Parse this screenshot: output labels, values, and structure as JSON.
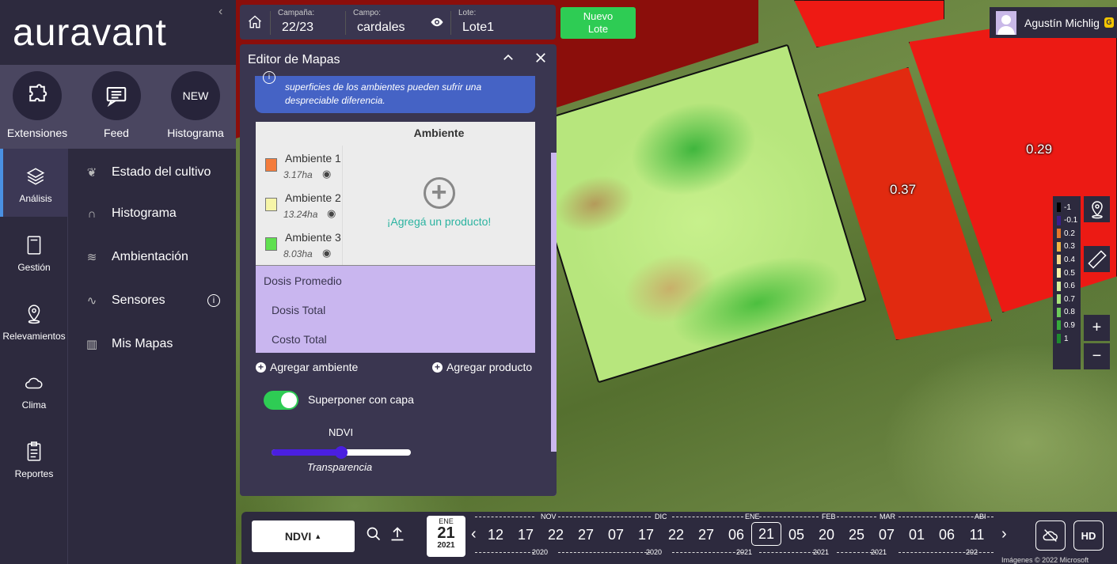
{
  "brand": {
    "logo_text": "auravant",
    "collapse_glyph": "‹"
  },
  "quick_actions": [
    {
      "label": "Extensiones",
      "icon": "puzzle-icon"
    },
    {
      "label": "Feed",
      "icon": "chat-icon"
    },
    {
      "label": "Histograma",
      "icon_text": "NEW"
    }
  ],
  "rail": [
    {
      "label": "Análisis",
      "icon": "layers-icon",
      "active": true
    },
    {
      "label": "Gestión",
      "icon": "notebook-icon"
    },
    {
      "label": "Relevamientos",
      "icon": "map-pin-icon"
    },
    {
      "label": "Clima",
      "icon": "cloud-icon"
    },
    {
      "label": "Reportes",
      "icon": "clipboard-icon"
    }
  ],
  "submenu": [
    {
      "label": "Estado del cultivo",
      "icon": "plant-icon"
    },
    {
      "label": "Histograma",
      "icon": "curve-icon"
    },
    {
      "label": "Ambientación",
      "icon": "layers-icon"
    },
    {
      "label": "Sensores",
      "icon": "wave-icon",
      "has_info": true
    },
    {
      "label": "Mis Mapas",
      "icon": "book-map-icon"
    }
  ],
  "topbar": {
    "campana_label": "Campaña:",
    "campana_value": "22/23",
    "campo_label": "Campo:",
    "campo_value": "cardales",
    "lote_label": "Lote:",
    "lote_value": "Lote1",
    "nuevo_lote": "Nuevo\nLote"
  },
  "user": {
    "name": "Agustín Michlig",
    "badge": "G"
  },
  "editor": {
    "title": "Editor de Mapas",
    "info_text": "superficies de los ambientes pueden sufrir una despreciable diferencia.",
    "column_header": "Ambiente",
    "ambientes": [
      {
        "name": "Ambiente 1",
        "ha": "3.17ha",
        "color": "#f47c3c"
      },
      {
        "name": "Ambiente 2",
        "ha": "13.24ha",
        "color": "#f6f5a8"
      },
      {
        "name": "Ambiente 3",
        "ha": "8.03ha",
        "color": "#5fe04f"
      }
    ],
    "add_product_text": "¡Agregá un producto!",
    "dosis_promedio": "Dosis Promedio",
    "dosis_total": "Dosis Total",
    "costo_total": "Costo Total",
    "agregar_ambiente": "Agregar ambiente",
    "agregar_producto": "Agregar producto",
    "overlay_label": "Superponer con capa",
    "overlay_on": true,
    "layer_name": "NDVI",
    "transparency_label": "Transparencia",
    "transparency_value": 0.5
  },
  "map": {
    "values": [
      "0.37",
      "0.29"
    ],
    "attribution": "Imágenes © 2022 Microsoft"
  },
  "legend": {
    "entries": [
      {
        "label": "-1",
        "color": "#000000"
      },
      {
        "label": "-0.1",
        "color": "#3b1f8a"
      },
      {
        "label": "0.2",
        "color": "#e0762c"
      },
      {
        "label": "0.3",
        "color": "#f0b443"
      },
      {
        "label": "0.4",
        "color": "#f3d98a"
      },
      {
        "label": "0.5",
        "color": "#f7f3a6"
      },
      {
        "label": "0.6",
        "color": "#d8f19a"
      },
      {
        "label": "0.7",
        "color": "#a9e37c"
      },
      {
        "label": "0.8",
        "color": "#6cc95a"
      },
      {
        "label": "0.9",
        "color": "#37a93b"
      },
      {
        "label": "1",
        "color": "#1e8a2e"
      }
    ],
    "zoom_in": "+",
    "zoom_out": "−"
  },
  "timeline": {
    "layer": "NDVI",
    "selected_month": "ENE",
    "selected_day": "21",
    "selected_year": "2021",
    "days": [
      "12",
      "17",
      "22",
      "27",
      "07",
      "17",
      "22",
      "27",
      "06",
      "21",
      "05",
      "20",
      "25",
      "07",
      "01",
      "06",
      "11"
    ],
    "selected_index": 9,
    "months": [
      "NOV",
      "DIC",
      "ENE",
      "FEB",
      "MAR",
      "ABI"
    ],
    "years": [
      "2020",
      "2020",
      "2021",
      "2021",
      "2021",
      "202"
    ],
    "hd_label": "HD"
  }
}
